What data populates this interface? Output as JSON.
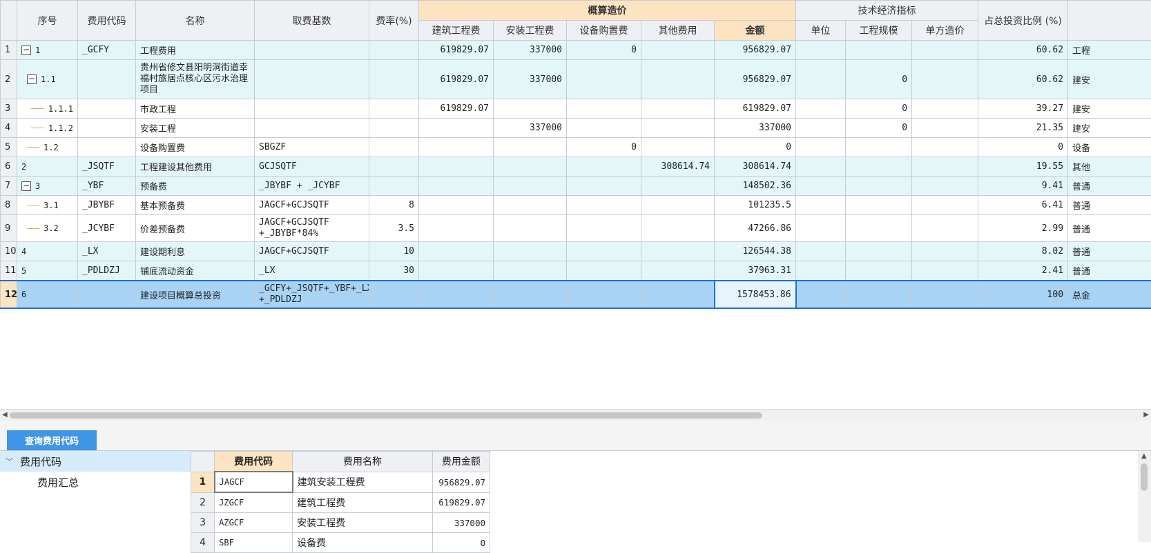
{
  "header": {
    "seq": "序号",
    "code": "费用代码",
    "name": "名称",
    "base": "取费基数",
    "rate": "费率(%)",
    "estimate_group": "概算造价",
    "build": "建筑工程费",
    "install": "安装工程费",
    "equip": "设备购置费",
    "other": "其他费用",
    "amount": "金额",
    "tech_group": "技术经济指标",
    "unit": "单位",
    "scale": "工程规模",
    "unit_cost": "单方造价",
    "ratio": "占总投资比例 (%)"
  },
  "rows": [
    {
      "rn": "1",
      "seq": "1",
      "code": "_GCFY",
      "name": "工程费用",
      "base": "",
      "rate": "",
      "build": "619829.07",
      "install": "337000",
      "equip": "0",
      "other": "",
      "amount": "956829.07",
      "unit": "",
      "scale": "",
      "unit_cost": "",
      "ratio": "60.62",
      "remark": "工程"
    },
    {
      "rn": "2",
      "seq": "1.1",
      "code": "",
      "name": "贵州省修文县阳明洞街道幸福村旅居点核心区污水治理项目",
      "base": "",
      "rate": "",
      "build": "619829.07",
      "install": "337000",
      "equip": "",
      "other": "",
      "amount": "956829.07",
      "unit": "",
      "scale": "0",
      "unit_cost": "",
      "ratio": "60.62",
      "remark": "建安"
    },
    {
      "rn": "3",
      "seq": "1.1.1",
      "code": "",
      "name": "市政工程",
      "base": "",
      "rate": "",
      "build": "619829.07",
      "install": "",
      "equip": "",
      "other": "",
      "amount": "619829.07",
      "unit": "",
      "scale": "0",
      "unit_cost": "",
      "ratio": "39.27",
      "remark": "建安"
    },
    {
      "rn": "4",
      "seq": "1.1.2",
      "code": "",
      "name": "安装工程",
      "base": "",
      "rate": "",
      "build": "",
      "install": "337000",
      "equip": "",
      "other": "",
      "amount": "337000",
      "unit": "",
      "scale": "0",
      "unit_cost": "",
      "ratio": "21.35",
      "remark": "建安"
    },
    {
      "rn": "5",
      "seq": "1.2",
      "code": "",
      "name": "设备购置费",
      "base": "SBGZF",
      "rate": "",
      "build": "",
      "install": "",
      "equip": "0",
      "other": "",
      "amount": "0",
      "unit": "",
      "scale": "",
      "unit_cost": "",
      "ratio": "0",
      "remark": "设备"
    },
    {
      "rn": "6",
      "seq": "2",
      "code": "_JSQTF",
      "name": "工程建设其他费用",
      "base": "GCJSQTF",
      "rate": "",
      "build": "",
      "install": "",
      "equip": "",
      "other": "308614.74",
      "amount": "308614.74",
      "unit": "",
      "scale": "",
      "unit_cost": "",
      "ratio": "19.55",
      "remark": "其他"
    },
    {
      "rn": "7",
      "seq": "3",
      "code": "_YBF",
      "name": "预备费",
      "base": "_JBYBF + _JCYBF",
      "rate": "",
      "build": "",
      "install": "",
      "equip": "",
      "other": "",
      "amount": "148502.36",
      "unit": "",
      "scale": "",
      "unit_cost": "",
      "ratio": "9.41",
      "remark": "普通"
    },
    {
      "rn": "8",
      "seq": "3.1",
      "code": "_JBYBF",
      "name": "基本预备费",
      "base": "JAGCF+GCJSQTF",
      "rate": "8",
      "build": "",
      "install": "",
      "equip": "",
      "other": "",
      "amount": "101235.5",
      "unit": "",
      "scale": "",
      "unit_cost": "",
      "ratio": "6.41",
      "remark": "普通"
    },
    {
      "rn": "9",
      "seq": "3.2",
      "code": "_JCYBF",
      "name": "价差预备费",
      "base": "JAGCF+GCJSQTF +_JBYBF*84%",
      "rate": "3.5",
      "build": "",
      "install": "",
      "equip": "",
      "other": "",
      "amount": "47266.86",
      "unit": "",
      "scale": "",
      "unit_cost": "",
      "ratio": "2.99",
      "remark": "普通"
    },
    {
      "rn": "10",
      "seq": "4",
      "code": "_LX",
      "name": "建设期利息",
      "base": "JAGCF+GCJSQTF",
      "rate": "10",
      "build": "",
      "install": "",
      "equip": "",
      "other": "",
      "amount": "126544.38",
      "unit": "",
      "scale": "",
      "unit_cost": "",
      "ratio": "8.02",
      "remark": "普通"
    },
    {
      "rn": "11",
      "seq": "5",
      "code": "_PDLDZJ",
      "name": "铺底流动资金",
      "base": "_LX",
      "rate": "30",
      "build": "",
      "install": "",
      "equip": "",
      "other": "",
      "amount": "37963.31",
      "unit": "",
      "scale": "",
      "unit_cost": "",
      "ratio": "2.41",
      "remark": "普通"
    },
    {
      "rn": "12",
      "seq": "6",
      "code": "",
      "name": "建设项目概算总投资",
      "base": "_GCFY+_JSQTF+_YBF+_LX +_PDLDZJ",
      "rate": "",
      "build": "",
      "install": "",
      "equip": "",
      "other": "",
      "amount": "1578453.86",
      "unit": "",
      "scale": "",
      "unit_cost": "",
      "ratio": "100",
      "remark": "总金"
    }
  ],
  "bottom": {
    "tab_label": "查询费用代码",
    "tree_root": "费用代码",
    "tree_child": "费用汇总",
    "grid_header": {
      "code": "费用代码",
      "name": "费用名称",
      "amount": "费用金额"
    },
    "grid_rows": [
      {
        "rn": "1",
        "code": "JAGCF",
        "name": "建筑安装工程费",
        "amount": "956829.07"
      },
      {
        "rn": "2",
        "code": "JZGCF",
        "name": "建筑工程费",
        "amount": "619829.07"
      },
      {
        "rn": "3",
        "code": "AZGCF",
        "name": "安装工程费",
        "amount": "337000"
      },
      {
        "rn": "4",
        "code": "SBF",
        "name": "设备费",
        "amount": "0"
      }
    ]
  },
  "colors": {
    "cyan_row": "#e3f7f8",
    "selected_row": "#a9d3f5",
    "header_highlight": "#fce3c2",
    "tab_blue": "#3f95e6"
  },
  "icons": {
    "collapse": "minus-box-icon",
    "scroll_left": "arrow-left-icon",
    "scroll_right": "arrow-right-icon",
    "tree_expand": "chevron-down-icon"
  }
}
